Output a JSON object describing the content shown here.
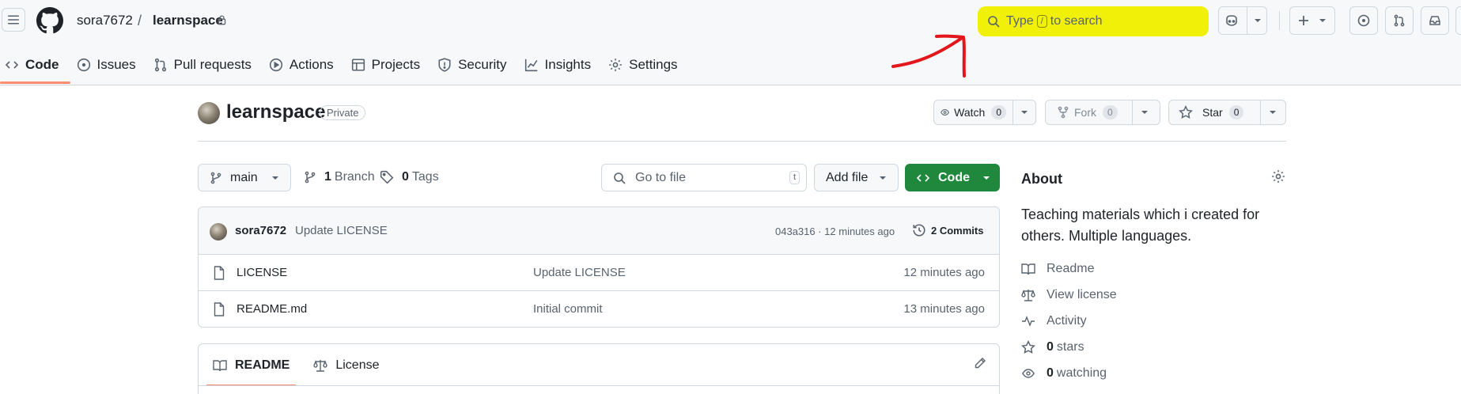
{
  "header": {
    "owner": "sora7672",
    "separator": "/",
    "repo": "learnspace",
    "search": {
      "prefix": "Type",
      "key": "/",
      "suffix": "to search"
    }
  },
  "tabs": [
    {
      "label": "Code",
      "icon": "code-icon",
      "active": true
    },
    {
      "label": "Issues",
      "icon": "issue-opened-icon"
    },
    {
      "label": "Pull requests",
      "icon": "git-pull-request-icon"
    },
    {
      "label": "Actions",
      "icon": "play-icon"
    },
    {
      "label": "Projects",
      "icon": "table-icon"
    },
    {
      "label": "Security",
      "icon": "shield-icon"
    },
    {
      "label": "Insights",
      "icon": "graph-icon"
    },
    {
      "label": "Settings",
      "icon": "gear-icon"
    }
  ],
  "repo_header": {
    "name": "learnspace",
    "visibility": "Private",
    "watch": {
      "label": "Watch",
      "count": "0"
    },
    "fork": {
      "label": "Fork",
      "count": "0"
    },
    "star": {
      "label": "Star",
      "count": "0"
    }
  },
  "file_nav": {
    "branch": "main",
    "branch_count": "1",
    "branch_label": "Branch",
    "tag_count": "0",
    "tag_label": "Tags",
    "go_to_file": "Go to file",
    "go_to_file_key": "t",
    "add_file": "Add file",
    "code": "Code"
  },
  "latest_commit": {
    "author": "sora7672",
    "message": "Update LICENSE",
    "sha_time": "043a316 · 12 minutes ago",
    "commits": "2 Commits"
  },
  "files": [
    {
      "name": "LICENSE",
      "message": "Update LICENSE",
      "date": "12 minutes ago"
    },
    {
      "name": "README.md",
      "message": "Initial commit",
      "date": "13 minutes ago"
    }
  ],
  "readme_tabs": [
    {
      "label": "README",
      "icon": "book-icon"
    },
    {
      "label": "License",
      "icon": "law-icon"
    }
  ],
  "about": {
    "title": "About",
    "description": "Teaching materials which i created for others. Multiple languages.",
    "readme": "Readme",
    "license": "View license",
    "activity": "Activity",
    "stars_count": "0",
    "stars_label": "stars",
    "watching_count": "0",
    "watching_label": "watching"
  },
  "colors": {
    "search_highlight": "#f1f009",
    "annotation_arrow": "#e3161b",
    "primary_button": "#1f883d",
    "active_tab_underline": "#fd8c73"
  }
}
